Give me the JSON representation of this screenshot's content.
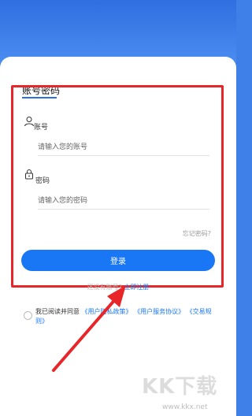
{
  "colors": {
    "accent": "#1977f5",
    "highlight": "#e8262a",
    "header_bg": "#3f7fe8"
  },
  "tab": {
    "title": "账号密码"
  },
  "account": {
    "icon": "user-icon",
    "label": "账号",
    "placeholder": "请输入您的账号"
  },
  "password": {
    "icon": "lock-icon",
    "label": "密码",
    "placeholder": "请输入您的密码"
  },
  "forgot_label": "忘记密码?",
  "login_label": "登录",
  "register": {
    "prompt": "还没有账号?",
    "link": "立即注册"
  },
  "agreement": {
    "prefix": "我已阅读并同意",
    "privacy": "《用户隐私政策》",
    "service": "《用户服务协议》",
    "trade": "《交易规则》"
  },
  "watermark": {
    "text": "KK下载",
    "url": "www.kkx.net"
  }
}
